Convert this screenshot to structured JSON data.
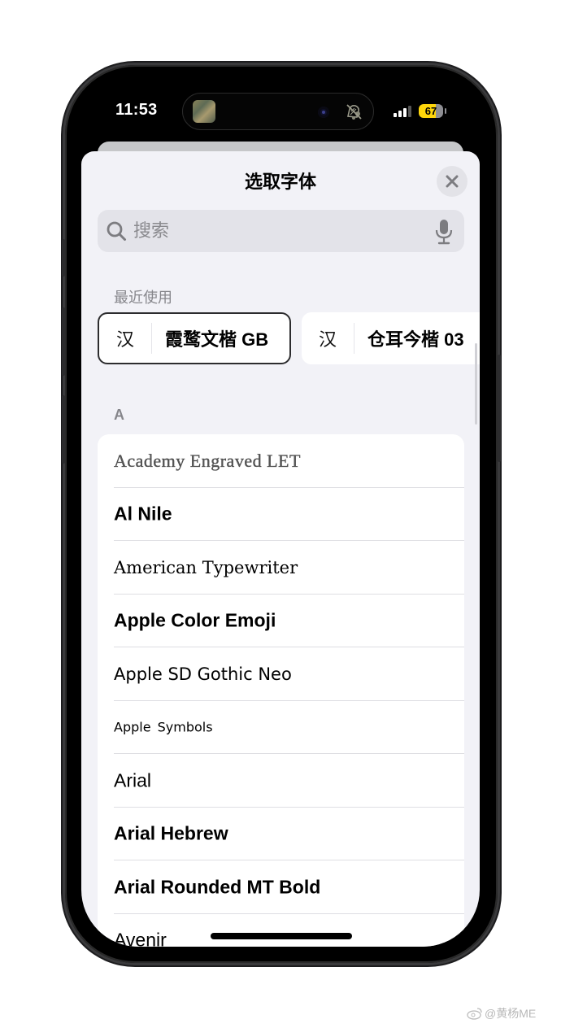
{
  "status_bar": {
    "time": "11:53",
    "battery_level": "67",
    "battery_color": "#ffd60a",
    "icons": [
      "now-playing-thumbnail",
      "camera",
      "mute-bell-icon",
      "signal-icon",
      "battery-icon"
    ]
  },
  "sheet": {
    "title": "选取字体",
    "close_icon": "close-icon"
  },
  "search": {
    "placeholder": "搜索",
    "value": "",
    "search_icon": "search-icon",
    "mic_icon": "microphone-icon"
  },
  "recent": {
    "label": "最近使用",
    "items": [
      {
        "glyph": "汉",
        "name": "霞鹜文楷 GB",
        "selected": true
      },
      {
        "glyph": "汉",
        "name": "仓耳今楷 03",
        "selected": false
      }
    ]
  },
  "section": {
    "letter": "A",
    "fonts": [
      {
        "name": "Academy Engraved LET"
      },
      {
        "name": "Al Nile"
      },
      {
        "name": "American Typewriter"
      },
      {
        "name": "Apple Color Emoji"
      },
      {
        "name": "Apple SD Gothic Neo"
      },
      {
        "name": "Apple Symbols"
      },
      {
        "name": "Arial"
      },
      {
        "name": "Arial Hebrew"
      },
      {
        "name": "Arial Rounded MT Bold"
      },
      {
        "name": "Avenir"
      }
    ]
  },
  "watermark": {
    "text": "@黄杨ME",
    "icon": "weibo-icon"
  }
}
